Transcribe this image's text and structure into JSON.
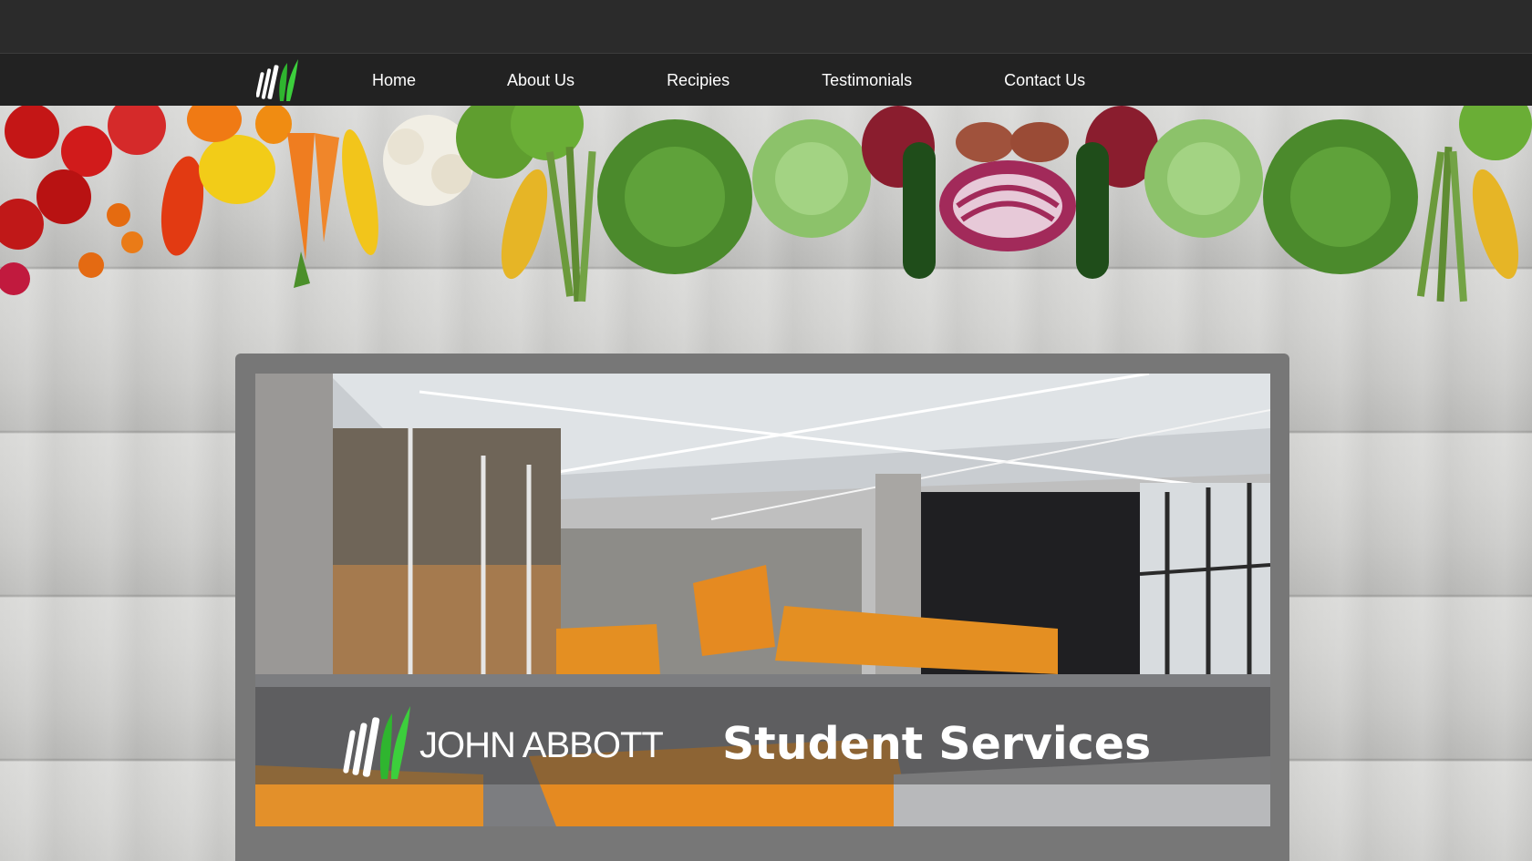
{
  "nav": {
    "items": [
      {
        "label": "Home"
      },
      {
        "label": "About Us"
      },
      {
        "label": "Recipies"
      },
      {
        "label": "Testimonials"
      },
      {
        "label": "Contact Us"
      }
    ]
  },
  "hero": {
    "brand": "JOHN ABBOTT",
    "title": "Student Services"
  },
  "colors": {
    "logo_green": "#2fb52f",
    "nav_bg": "#222222",
    "topbar_bg": "#2b2b2b",
    "card_frame": "#777777",
    "accent_orange": "#e8862a"
  },
  "icons": [
    "logo-icon"
  ]
}
